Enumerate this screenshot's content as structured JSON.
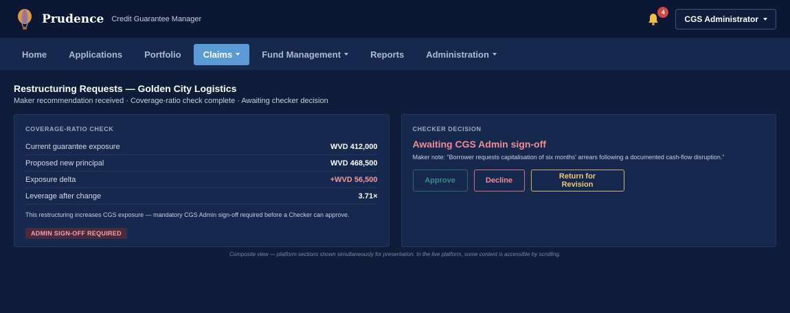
{
  "header": {
    "brand": "Prudence",
    "tagline": "Credit Guarantee Manager",
    "notification_count": "4",
    "user_label": "CGS Administrator"
  },
  "nav": {
    "items": [
      {
        "label": "Home"
      },
      {
        "label": "Applications"
      },
      {
        "label": "Portfolio"
      },
      {
        "label": "Claims"
      },
      {
        "label": "Fund Management"
      },
      {
        "label": "Reports"
      },
      {
        "label": "Administration"
      }
    ],
    "active": "Claims"
  },
  "page": {
    "title": "Restructuring Requests — Golden City Logistics",
    "subtitle": "Maker recommendation received · Coverage-ratio check complete · Awaiting checker decision"
  },
  "coverage": {
    "label": "COVERAGE-RATIO CHECK",
    "rows": [
      {
        "label": "Current guarantee exposure",
        "value": "WVD 412,000"
      },
      {
        "label": "Proposed new principal",
        "value": "WVD 468,500"
      },
      {
        "label": "Exposure delta",
        "value": "+WVD 56,500"
      },
      {
        "label": "Leverage after change",
        "value": "3.71×"
      }
    ],
    "note": "This restructuring increases CGS exposure — mandatory CGS Admin sign-off required before a Checker can approve.",
    "badge": "ADMIN SIGN-OFF REQUIRED"
  },
  "decision": {
    "label": "CHECKER DECISION",
    "status": "Awaiting CGS Admin sign-off",
    "maker_note": "Maker note: “Borrower requests capitalisation of six months' arrears following a documented cash-flow disruption.”",
    "approve_label": "Approve",
    "decline_label": "Decline",
    "revise_label": "Return for Revision"
  },
  "footnote": "Composite view — platform sections shown simultaneously for presentation. In the live platform, some content is accessible by scrolling.",
  "colors": {
    "background": "#0f1c3a",
    "nav_active": "#5b9bd5",
    "alert": "#f38b94",
    "warning": "#ecc774"
  }
}
